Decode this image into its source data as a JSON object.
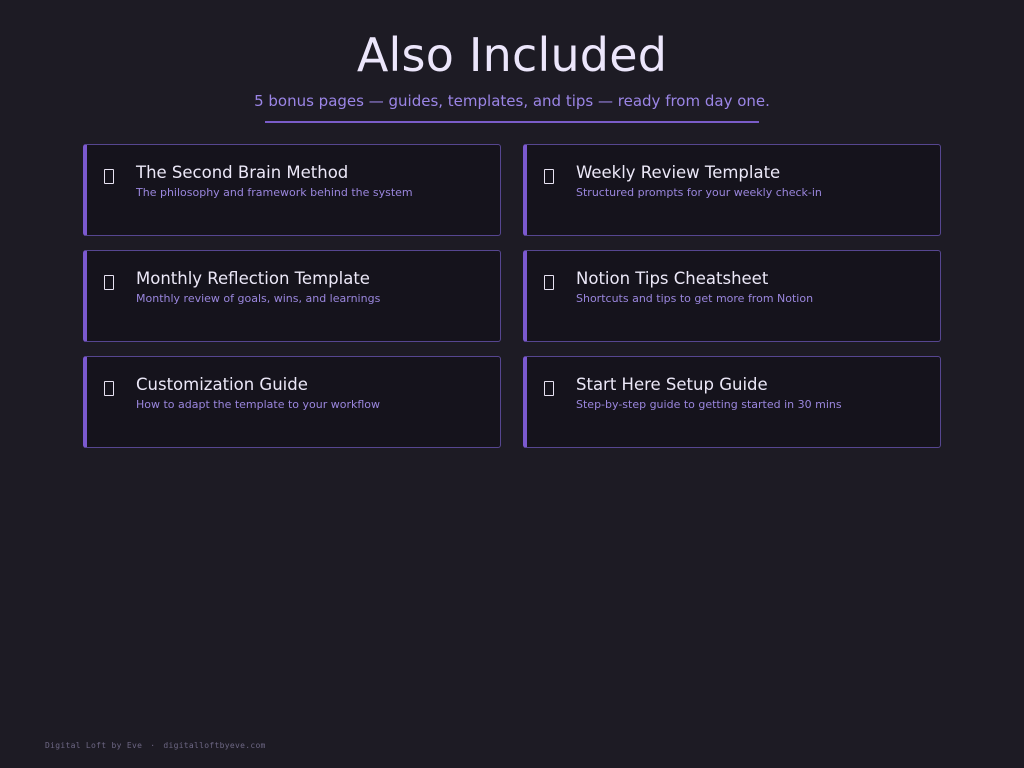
{
  "header": {
    "title": "Also Included",
    "subtitle": "5 bonus pages — guides, templates, and tips — ready from day one."
  },
  "cards": [
    {
      "title": "The Second Brain Method",
      "description": "The philosophy and framework behind the system",
      "icon": "page-icon"
    },
    {
      "title": "Weekly Review Template",
      "description": "Structured prompts for your weekly check-in",
      "icon": "page-icon"
    },
    {
      "title": "Monthly Reflection Template",
      "description": "Monthly review of goals, wins, and learnings",
      "icon": "page-icon"
    },
    {
      "title": "Notion Tips Cheatsheet",
      "description": "Shortcuts and tips to get more from Notion",
      "icon": "page-icon"
    },
    {
      "title": "Customization Guide",
      "description": "How to adapt the template to your workflow",
      "icon": "page-icon"
    },
    {
      "title": "Start Here Setup Guide",
      "description": "Step-by-step guide to getting started in 30 mins",
      "icon": "page-icon"
    }
  ],
  "footer": {
    "brand": "Digital Loft by Eve",
    "separator": "·",
    "url": "digitalloftbyeve.com"
  },
  "colors": {
    "background": "#1d1b24",
    "accent": "#7b59cf",
    "subtitle": "#9b85e6"
  }
}
